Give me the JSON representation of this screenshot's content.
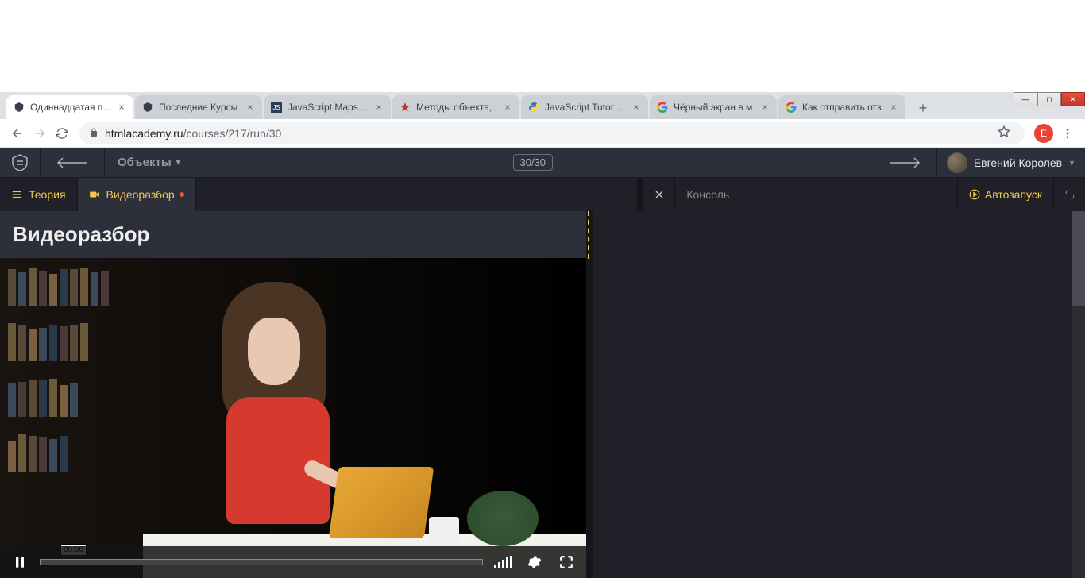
{
  "browser": {
    "tabs": [
      {
        "title": "Одиннадцатая про",
        "active": true,
        "favicon": "shield"
      },
      {
        "title": "Последние Курсы",
        "active": false,
        "favicon": "shield"
      },
      {
        "title": "JavaScript Maps vs",
        "active": false,
        "favicon": "js"
      },
      {
        "title": "Методы объекта,",
        "active": false,
        "favicon": "star"
      },
      {
        "title": "JavaScript Tutor - V",
        "active": false,
        "favicon": "python"
      },
      {
        "title": "Чёрный экран в м",
        "active": false,
        "favicon": "g"
      },
      {
        "title": "Как отправить отз",
        "active": false,
        "favicon": "g"
      }
    ],
    "url_host": "htmlacademy.ru",
    "url_path": "/courses/217/run/30",
    "profile_initial": "E"
  },
  "header": {
    "course_name": "Объекты",
    "progress": "30/30",
    "user_name": "Евгений Королев"
  },
  "tabs": {
    "theory": "Теория",
    "video": "Видеоразбор",
    "console": "Консоль",
    "autorun": "Автозапуск"
  },
  "content": {
    "title": "Видеоразбор"
  },
  "video": {
    "time": "00:00"
  }
}
